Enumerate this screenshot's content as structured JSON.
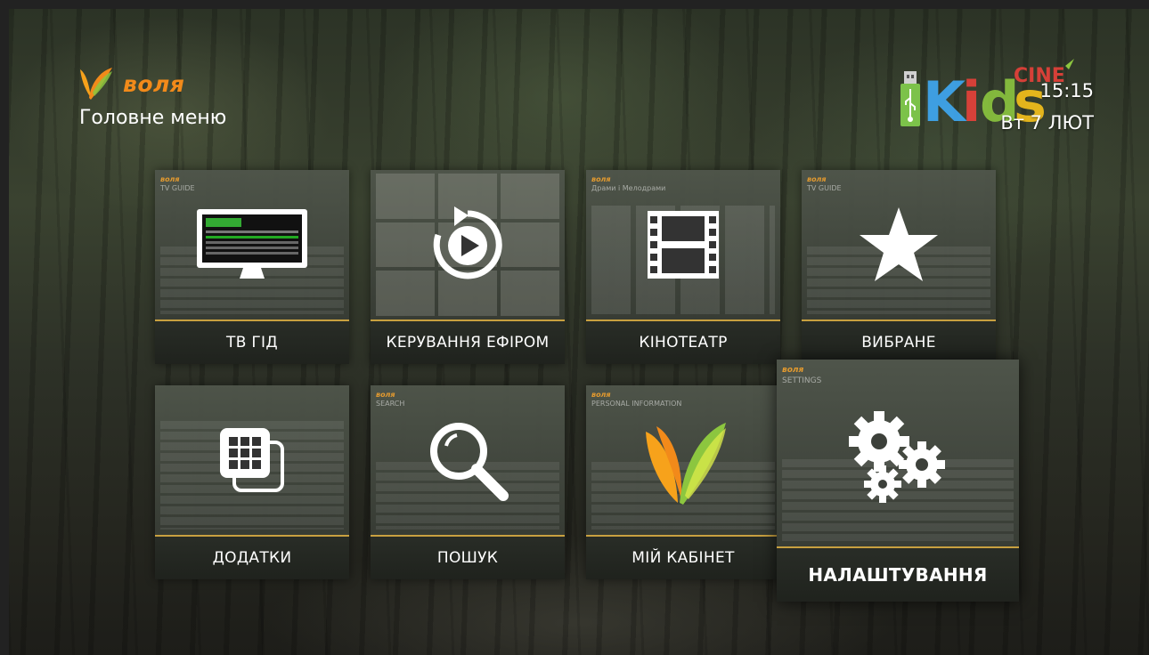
{
  "brand": {
    "name": "воля",
    "color": "#f28a1a"
  },
  "header": {
    "title": "Головне меню"
  },
  "status": {
    "time": "15:15",
    "date": "Вт 7 ЛЮТ",
    "usb_icon": "usb-icon",
    "channel": "Kids CINE+"
  },
  "menu": {
    "tiles": [
      {
        "label": "ТВ ГІД",
        "icon": "tv-monitor-icon",
        "caption": "TV GUIDE",
        "selected": false
      },
      {
        "label": "КЕРУВАННЯ ЕФІРОМ",
        "icon": "replay-play-icon",
        "caption": "",
        "selected": false
      },
      {
        "label": "КІНОТЕАТР",
        "icon": "film-strip-icon",
        "caption": "Драми і Мелодрами",
        "selected": false
      },
      {
        "label": "ВИБРАНЕ",
        "icon": "star-icon",
        "caption": "TV GUIDE",
        "selected": false
      },
      {
        "label": "ДОДАТКИ",
        "icon": "apps-grid-icon",
        "caption": "",
        "selected": false
      },
      {
        "label": "ПОШУК",
        "icon": "search-icon",
        "caption": "SEARCH",
        "selected": false
      },
      {
        "label": "МІЙ КАБІНЕТ",
        "icon": "volia-logo-icon",
        "caption": "PERSONAL INFORMATION",
        "selected": false
      },
      {
        "label": "НАЛАШТУВАННЯ",
        "icon": "gears-icon",
        "caption": "SETTINGS",
        "selected": true
      }
    ]
  },
  "colors": {
    "accent": "#c8a040",
    "tile_bg": "#3a3e38"
  }
}
